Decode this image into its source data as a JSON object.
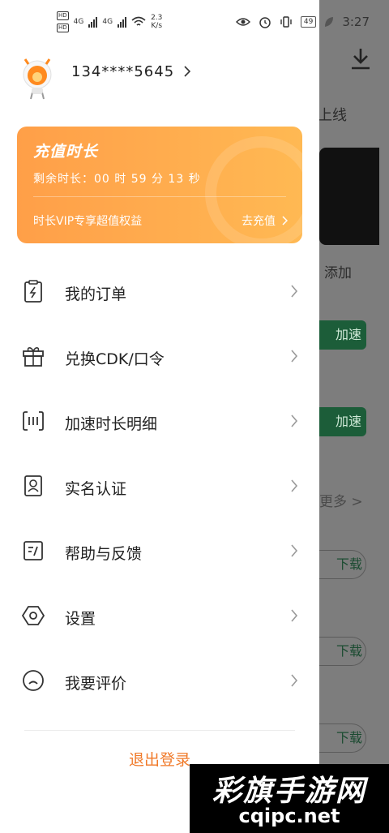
{
  "status_bar": {
    "hd1": "HD",
    "hd2": "HD",
    "net1": "4G",
    "net2": "4G",
    "speed": "2.3",
    "speed_unit": "K/s",
    "battery": "49",
    "time": "3:27"
  },
  "background_app": {
    "title_fragment": "上线",
    "add_label": "添加",
    "accelerate_buttons": [
      "加速",
      "加速"
    ],
    "more_label": "更多 >",
    "download_buttons": [
      "下载",
      "下载",
      "下载"
    ]
  },
  "profile": {
    "phone": "134****5645"
  },
  "recharge_card": {
    "title": "充值时长",
    "remaining": "剩余时长：00 时 59 分 13 秒",
    "vip_text": "时长VIP专享超值权益",
    "recharge_link": "去充值"
  },
  "menu": [
    {
      "label": "我的订单",
      "icon": "order-icon"
    },
    {
      "label": "兑换CDK/口令",
      "icon": "gift-icon"
    },
    {
      "label": "加速时长明细",
      "icon": "speed-detail-icon"
    },
    {
      "label": "实名认证",
      "icon": "id-card-icon"
    },
    {
      "label": "帮助与反馈",
      "icon": "feedback-icon"
    },
    {
      "label": "设置",
      "icon": "settings-icon"
    },
    {
      "label": "我要评价",
      "icon": "rate-icon"
    }
  ],
  "logout_label": "退出登录",
  "watermark": {
    "top": "彩旗手游网",
    "bottom": "cqipc.net"
  },
  "colors": {
    "accent": "#f07a2a",
    "card_start": "#ff9f48",
    "card_end": "#ffb953",
    "bg_green": "#1c5d39"
  }
}
